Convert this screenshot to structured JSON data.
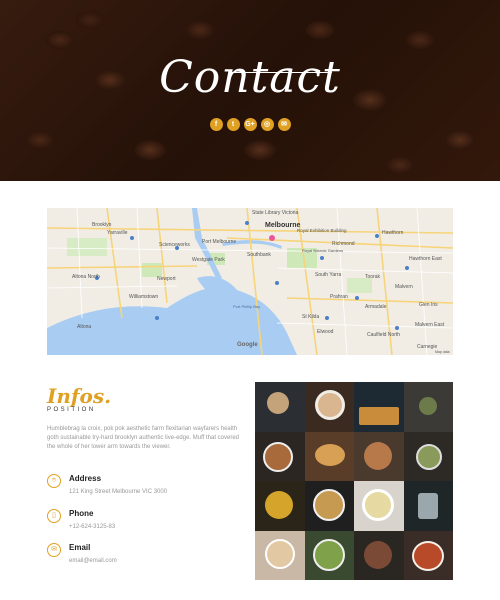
{
  "hero": {
    "title": "Contact",
    "social_icons": [
      {
        "name": "facebook-icon",
        "glyph": "f"
      },
      {
        "name": "twitter-icon",
        "glyph": "t"
      },
      {
        "name": "google-plus-icon",
        "glyph": "G+"
      },
      {
        "name": "instagram-icon",
        "glyph": "◎"
      },
      {
        "name": "mail-icon",
        "glyph": "✉"
      }
    ]
  },
  "map": {
    "city": "Melbourne",
    "labels": [
      "State Library Victoria",
      "Royal Exhibition Building",
      "Melbourne",
      "Brooklyn",
      "Yarraville",
      "Scienceworks",
      "Port Melbourne",
      "Westgate Park",
      "Southbank",
      "Royal Botanic Gardens",
      "Richmond",
      "Hawthorn",
      "Hawthorn East",
      "Toorak",
      "South Yarra",
      "Prahran",
      "Malvern",
      "Armadale",
      "Glen Iris",
      "Williamstown",
      "Newport",
      "Altona North",
      "Altona",
      "St Kilda",
      "Port Phillip Bay",
      "Elwood",
      "Caulfield North",
      "Malvern East",
      "Carnegie"
    ],
    "attribution": "Google",
    "map_data": "Map data"
  },
  "info": {
    "script_title": "Infos.",
    "subtitle": "POSITION",
    "description": "Humblebrag la croix, pok pok aesthetic farm flexitarian wayfarers health goth sustainable try-hard brooklyn authentic live-edge. Muff that covered the whole of her lower arm towards the viewer.",
    "address_label": "Address",
    "address_value": "121 King Street Melbourne VIC 3000",
    "phone_label": "Phone",
    "phone_value": "+12-624-3125-83",
    "email_label": "Email",
    "email_value": "email@email.com"
  },
  "colors": {
    "accent": "#e0a024",
    "hero_dark": "#3a1d10"
  }
}
